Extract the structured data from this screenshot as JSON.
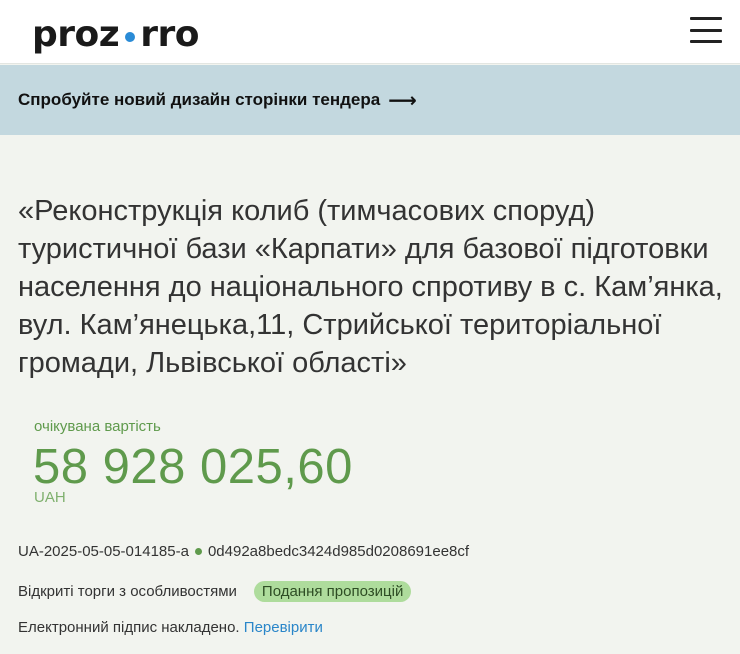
{
  "header": {
    "logo_left": "proz",
    "logo_right": "rro",
    "accent_color": "#2a8bd6"
  },
  "banner": {
    "text": "Спробуйте новий дизайн сторінки тендера",
    "arrow": "⟶"
  },
  "tender": {
    "title": "«Реконструкція колиб (тимчасових споруд) туристичної бази «Карпати» для базової підготовки населення до національного спротиву в с. Кам’янка, вул. Кам’янецька,11, Стрийської територіальної громади, Львівської області»",
    "price_label": "очікувана вартість",
    "price": "58 928 025,60",
    "currency": "UAH",
    "tender_id": "UA-2025-05-05-014185-a",
    "hash": "0d492a8bedc3424d985d0208691ee8cf",
    "procedure_type": "Відкриті торги з особливостями",
    "status": "Подання пропозицій",
    "signature_text": "Електронний підпис накладено.",
    "verify_link": "Перевірити"
  },
  "colors": {
    "price_green": "#5f9a4c",
    "badge_green": "#aedc9c",
    "banner_bg": "#c3d8df",
    "link_blue": "#2a86c9"
  }
}
